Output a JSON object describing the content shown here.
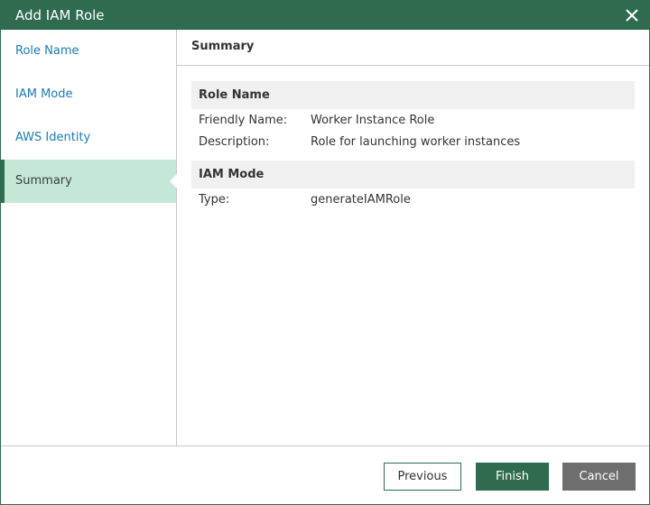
{
  "window": {
    "title": "Add IAM Role"
  },
  "sidebar": {
    "items": [
      {
        "label": "Role Name"
      },
      {
        "label": "IAM Mode"
      },
      {
        "label": "AWS Identity"
      },
      {
        "label": "Summary"
      }
    ],
    "active_index": 3
  },
  "content": {
    "title": "Summary",
    "sections": [
      {
        "heading": "Role Name",
        "rows": [
          {
            "label": "Friendly Name:",
            "value": "Worker Instance Role"
          },
          {
            "label": "Description:",
            "value": "Role for launching worker instances"
          }
        ]
      },
      {
        "heading": "IAM Mode",
        "rows": [
          {
            "label": "Type:",
            "value": "generateIAMRole"
          }
        ]
      }
    ]
  },
  "footer": {
    "previous_label": "Previous",
    "finish_label": "Finish",
    "cancel_label": "Cancel"
  },
  "colors": {
    "accent": "#2e6b4f",
    "active_item_bg": "#c3e8d8",
    "link": "#1a7bb9",
    "section_bg": "#f0f0f0",
    "cancel_bg": "#6e6e6e"
  },
  "icons": {
    "close": "close-icon"
  }
}
